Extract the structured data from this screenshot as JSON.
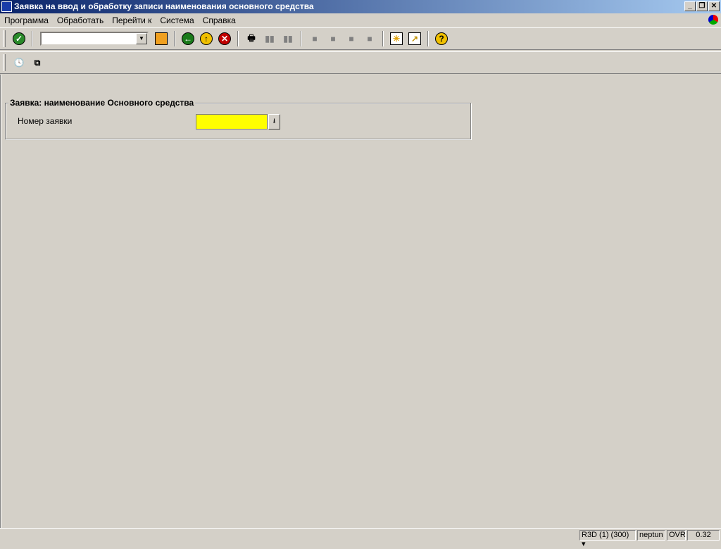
{
  "window": {
    "title": "Заявка на ввод и обработку записи наименования основного средства"
  },
  "menu": [
    "Программа",
    "Обработать",
    "Перейти к",
    "Система",
    "Справка"
  ],
  "toolbar": {
    "command_field": ""
  },
  "group": {
    "title": "Заявка: наименование Основного средства",
    "field_label": "Номер заявки",
    "field_value": ""
  },
  "status": {
    "system": "R3D (1) (300)",
    "server": "neptun",
    "mode": "OVR",
    "time": "0.32"
  },
  "colors": {
    "field": "#ffff00",
    "title_start": "#0a246a",
    "title_end": "#a6caf0"
  }
}
